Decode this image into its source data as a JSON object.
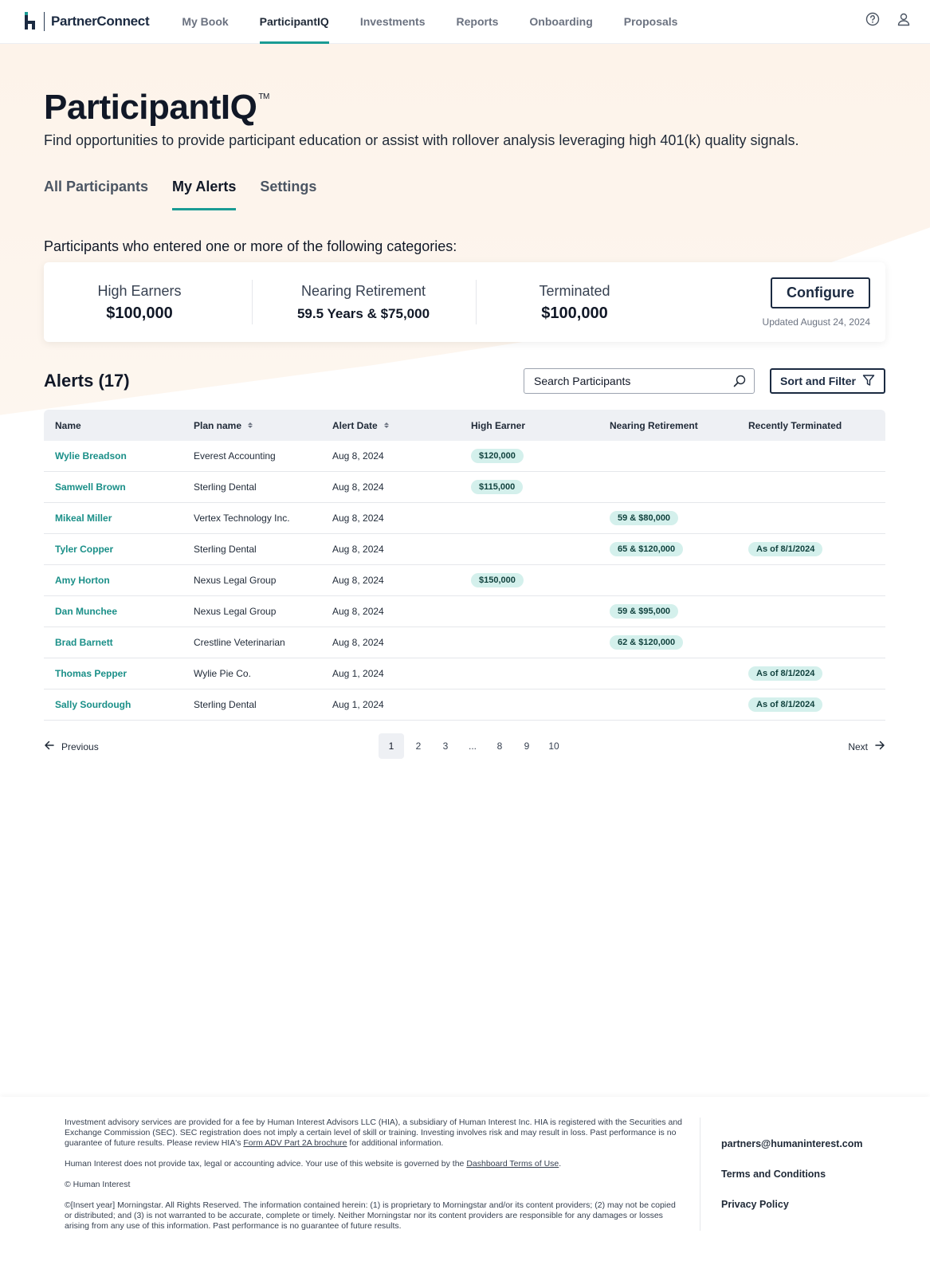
{
  "brand": {
    "name": "PartnerConnect"
  },
  "nav": {
    "links": [
      "My Book",
      "ParticipantIQ",
      "Investments",
      "Reports",
      "Onboarding",
      "Proposals"
    ],
    "active": "ParticipantIQ",
    "icons": [
      "help-icon",
      "user-icon"
    ]
  },
  "page": {
    "title": "ParticipantIQ",
    "trademark": "TM",
    "subtitle": "Find opportunities to provide participant education or assist with rollover analysis leveraging high 401(k) quality signals."
  },
  "tabs": {
    "items": [
      "All Participants",
      "My Alerts",
      "Settings"
    ],
    "active": "My Alerts"
  },
  "categories": {
    "intro": "Participants who entered one or more of the following categories:",
    "items": [
      {
        "label": "High Earners",
        "value": "$100,000"
      },
      {
        "label": "Nearing Retirement",
        "value": "59.5 Years & $75,000"
      },
      {
        "label": "Terminated",
        "value": "$100,000"
      }
    ],
    "configure_label": "Configure",
    "updated": "Updated August 24, 2024"
  },
  "alerts": {
    "title": "Alerts (17)",
    "search_placeholder": "Search Participants",
    "sort_filter_label": "Sort and Filter",
    "columns": [
      "Name",
      "Plan name",
      "Alert Date",
      "High Earner",
      "Nearing Retirement",
      "Recently Terminated"
    ],
    "rows": [
      {
        "name": "Wylie Breadson",
        "plan": "Everest Accounting",
        "date": "Aug 8, 2024",
        "high_earner": "$120,000",
        "nearing": "",
        "terminated": ""
      },
      {
        "name": "Samwell Brown",
        "plan": "Sterling Dental",
        "date": "Aug 8, 2024",
        "high_earner": "$115,000",
        "nearing": "",
        "terminated": ""
      },
      {
        "name": "Mikeal Miller",
        "plan": "Vertex Technology Inc.",
        "date": "Aug 8, 2024",
        "high_earner": "",
        "nearing": "59 & $80,000",
        "terminated": ""
      },
      {
        "name": "Tyler Copper",
        "plan": "Sterling Dental",
        "date": "Aug 8, 2024",
        "high_earner": "",
        "nearing": "65 & $120,000",
        "terminated": "As of 8/1/2024"
      },
      {
        "name": "Amy Horton",
        "plan": "Nexus Legal Group",
        "date": "Aug 8, 2024",
        "high_earner": "$150,000",
        "nearing": "",
        "terminated": ""
      },
      {
        "name": "Dan Munchee",
        "plan": "Nexus Legal Group",
        "date": "Aug 8, 2024",
        "high_earner": "",
        "nearing": "59 & $95,000",
        "terminated": ""
      },
      {
        "name": "Brad Barnett",
        "plan": "Crestline Veterinarian",
        "date": "Aug 8, 2024",
        "high_earner": "",
        "nearing": "62 & $120,000",
        "terminated": ""
      },
      {
        "name": "Thomas Pepper",
        "plan": "Wylie Pie Co.",
        "date": "Aug 1, 2024",
        "high_earner": "",
        "nearing": "",
        "terminated": "As of 8/1/2024"
      },
      {
        "name": "Sally Sourdough",
        "plan": "Sterling Dental",
        "date": "Aug 1, 2024",
        "high_earner": "",
        "nearing": "",
        "terminated": "As of 8/1/2024"
      }
    ]
  },
  "pagination": {
    "previous": "Previous",
    "next": "Next",
    "pages": [
      "1",
      "2",
      "3",
      "...",
      "8",
      "9",
      "10"
    ],
    "current": "1"
  },
  "footer": {
    "disclosure_1a": "Investment advisory services are provided for a fee by Human Interest Advisors LLC (HIA), a subsidiary of Human Interest Inc. HIA is registered with the Securities and Exchange Commission (SEC). SEC registration does not imply a certain level of skill or training. Investing involves risk and may result in loss. Past performance is no guarantee of future results. Please review HIA's ",
    "disclosure_1_link": "Form ADV Part 2A brochure",
    "disclosure_1b": " for additional information.",
    "disclosure_2a": "Human Interest does not provide tax, legal or accounting advice. Your use of this website is governed by the ",
    "disclosure_2_link": "Dashboard Terms of Use",
    "disclosure_2b": ".",
    "copyright": "© Human Interest",
    "morningstar": "©[Insert year] Morningstar.  All Rights Reserved.  The information contained herein: (1) is proprietary to Morningstar and/or its content providers; (2) may not be copied or distributed; and (3) is not warranted to be accurate, complete or timely.  Neither Morningstar nor its content providers are responsible for any damages or losses arising from any use of this information.  Past performance is no guarantee of future results.",
    "email": "partners@humaninterest.com",
    "terms": "Terms and Conditions",
    "privacy": "Privacy Policy"
  },
  "colors": {
    "accent": "#1a9b94",
    "pill_bg": "#d4f0ec",
    "navy": "#1b2a41",
    "bg_warm": "#fdf3ea"
  }
}
